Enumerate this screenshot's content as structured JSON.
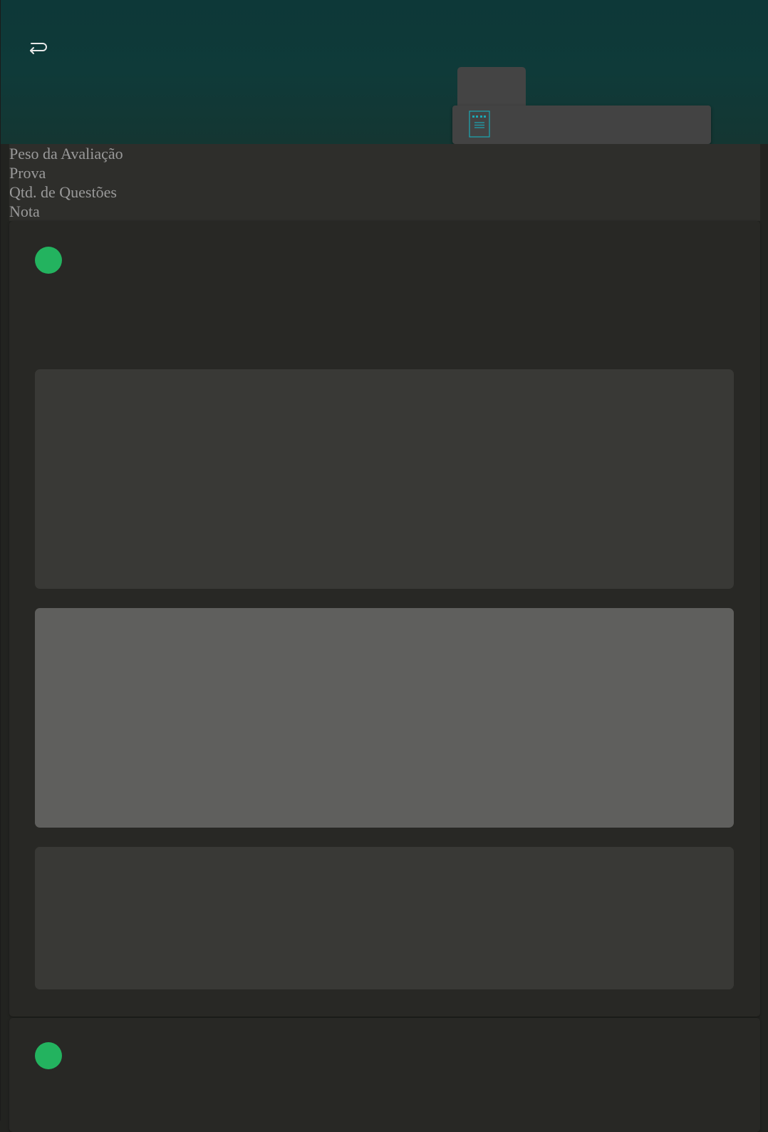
{
  "header": {
    "back_icon": "return-arrow-icon",
    "document_icon": "document-list-icon",
    "colors": {
      "header_top": "#0d3838",
      "header_bottom": "#143632",
      "accent": "#1ba8b5"
    }
  },
  "summary": {
    "lines": [
      "Peso da Avaliação",
      "Prova",
      "Qtd. de Questões",
      "Nota"
    ]
  },
  "cards": [
    {
      "status_color": "#23b35f",
      "blocks": [
        {
          "color": "#393936"
        },
        {
          "color": "#5f5f5d"
        },
        {
          "color": "#393936"
        }
      ]
    },
    {
      "status_color": "#23b35f"
    }
  ]
}
